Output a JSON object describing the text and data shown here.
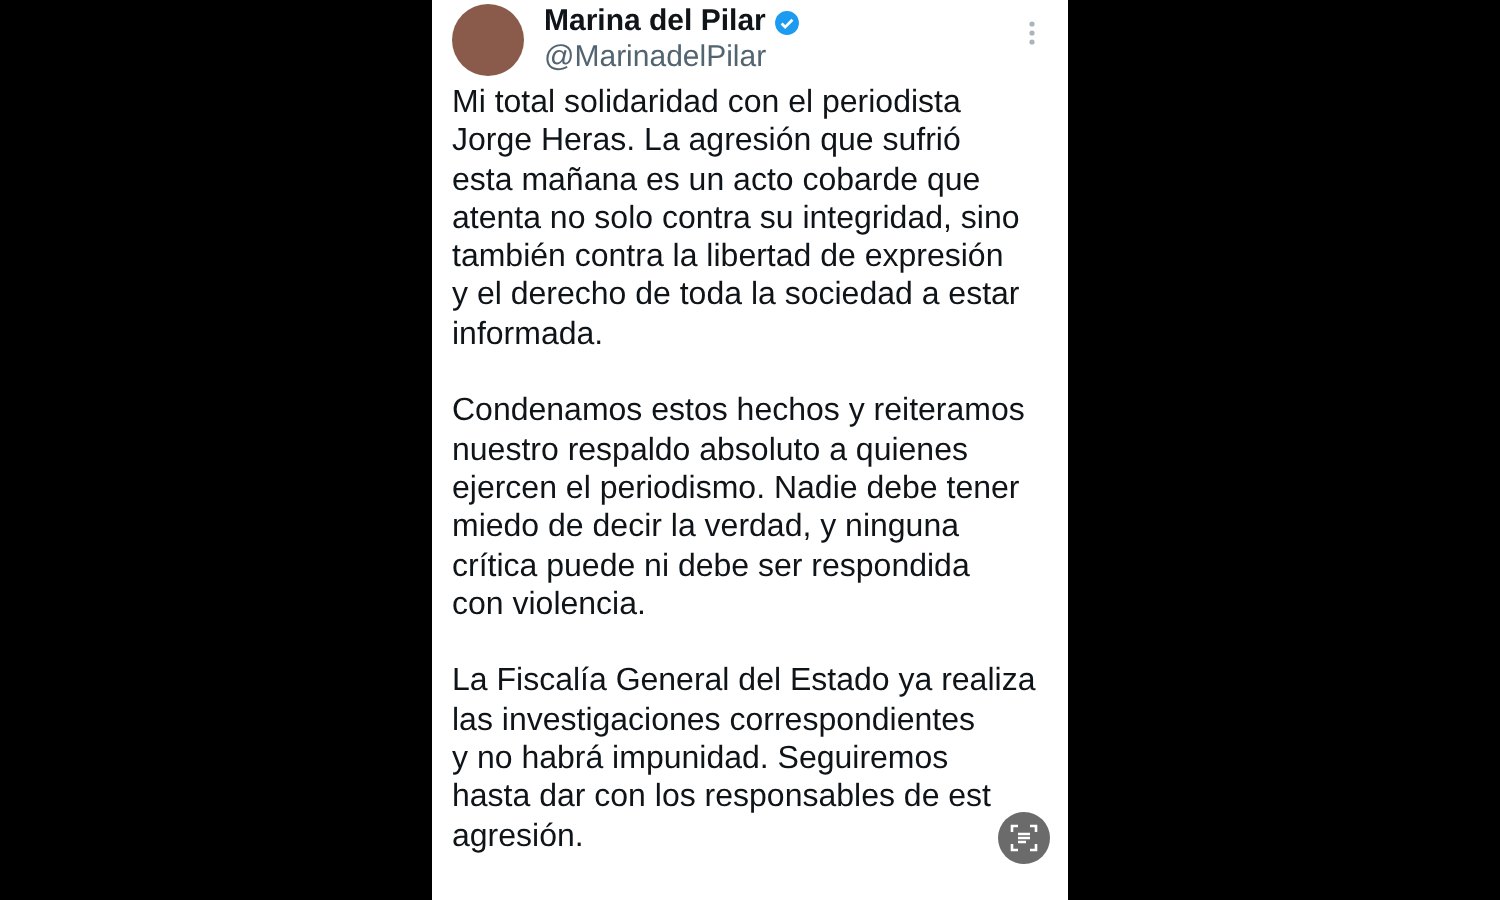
{
  "post": {
    "author": {
      "name": "Marina del Pilar",
      "verified": true,
      "handle": "@MarinadelPilar"
    },
    "paragraphs": [
      [
        "Mi total solidaridad con el periodista",
        "Jorge Heras. La agresión que sufrió",
        "esta mañana es un acto cobarde que",
        "atenta no solo contra su integridad, sino",
        "también contra la libertad de expresión",
        "y el derecho de toda la sociedad a estar",
        "informada."
      ],
      [
        "Condenamos estos hechos y reiteramos",
        "nuestro respaldo absoluto a quienes",
        "ejercen el periodismo. Nadie debe tener",
        "miedo de decir la verdad, y ninguna",
        "crítica puede ni debe ser respondida",
        "con violencia."
      ],
      [
        "La Fiscalía General del Estado ya realiza",
        "las investigaciones correspondientes",
        "y no habrá impunidad. Seguiremos",
        "hasta dar con los responsables de est",
        "agresión."
      ]
    ]
  }
}
